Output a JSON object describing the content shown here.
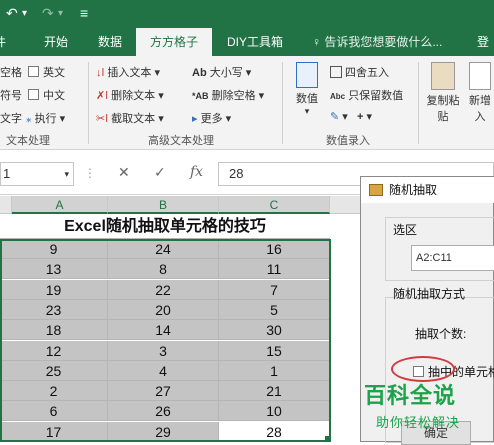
{
  "qat": {
    "undo": "↶",
    "undo_dropdown": "▾",
    "redo": "↷",
    "redo_dropdown": "▾",
    "customize": "≡"
  },
  "tabs": [
    "开始",
    "数据",
    "方方格子",
    "DIY工具箱"
  ],
  "active_tab": "方方格子",
  "tellme": "告诉我您想要做什么...",
  "user_initial": "登",
  "ribbon": {
    "text_group": {
      "items_left": [
        "空格",
        "符号",
        "文字"
      ],
      "items_right": [
        "英文",
        "中文",
        "执行"
      ],
      "execute_dropdown": "▾",
      "label": "文本处理"
    },
    "advanced_group": {
      "items": [
        "插入文本",
        "删除文本",
        "截取文本"
      ],
      "items2": [
        "大小写",
        "删除空格",
        "更多"
      ],
      "label": "高级文本处理"
    },
    "number_group": {
      "numeric": "数值",
      "round": "四舍五入",
      "keep_number": "只保留数值",
      "label": "数值录入"
    },
    "paste": {
      "label1": "复制粘",
      "label2": "贴"
    },
    "add": {
      "label1": "新增",
      "label2": "入"
    }
  },
  "formula_bar": {
    "name_box": "1",
    "cancel": "✕",
    "enter": "✓",
    "fx": "fx",
    "value": "28"
  },
  "sheet": {
    "columns": [
      "A",
      "B",
      "C"
    ],
    "title": "Excel随机抽取单元格的技巧",
    "rows": [
      [
        "9",
        "24",
        "16"
      ],
      [
        "13",
        "8",
        "11"
      ],
      [
        "19",
        "22",
        "7"
      ],
      [
        "23",
        "20",
        "5"
      ],
      [
        "18",
        "14",
        "30"
      ],
      [
        "12",
        "3",
        "15"
      ],
      [
        "25",
        "4",
        "1"
      ],
      [
        "2",
        "27",
        "21"
      ],
      [
        "6",
        "26",
        "10"
      ],
      [
        "17",
        "29",
        "28"
      ]
    ]
  },
  "dialog": {
    "title": "随机抽取",
    "range_label": "选区",
    "range_value": "A2:C11",
    "method_label": "随机抽取方式",
    "count_label": "抽取个数:",
    "checkbox_label": "抽中的单元格",
    "button_label": "确定"
  },
  "watermark": {
    "logo": "百科全说",
    "sub": "助你轻松解决"
  },
  "colors": {
    "excel_green": "#217346",
    "selection": "#c4c4c4",
    "circle": "#d23c3c",
    "watermark": "#1aa34a"
  }
}
